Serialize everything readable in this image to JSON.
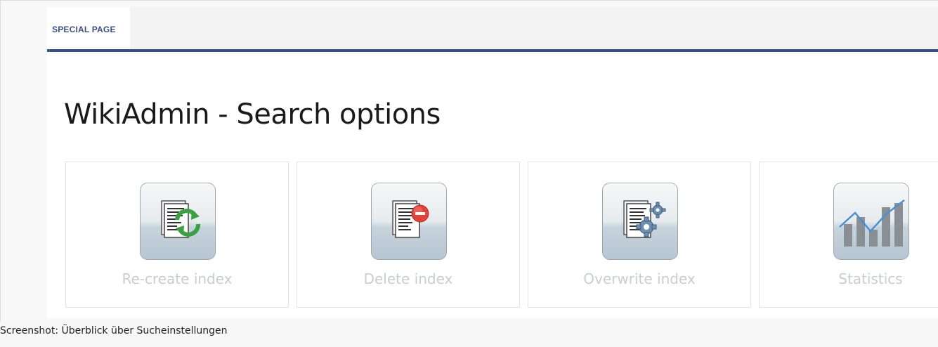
{
  "tab": {
    "label": "SPECIAL PAGE"
  },
  "page": {
    "title": "WikiAdmin - Search options"
  },
  "tiles": [
    {
      "label": "Re-create index",
      "icon": "document-refresh-icon"
    },
    {
      "label": "Delete index",
      "icon": "document-delete-icon"
    },
    {
      "label": "Overwrite index",
      "icon": "document-gears-icon"
    },
    {
      "label": "Statistics",
      "icon": "statistics-chart-icon"
    }
  ],
  "caption": {
    "text": "Screenshot: Überblick über Sucheinstellungen"
  },
  "colors": {
    "tab_text": "#3c5088",
    "tab_underline": "#394f82",
    "tile_label": "#c9cdd1",
    "refresh_green": "#3aa142",
    "delete_red": "#e2413a",
    "gear_blue": "#6f8fb0"
  }
}
